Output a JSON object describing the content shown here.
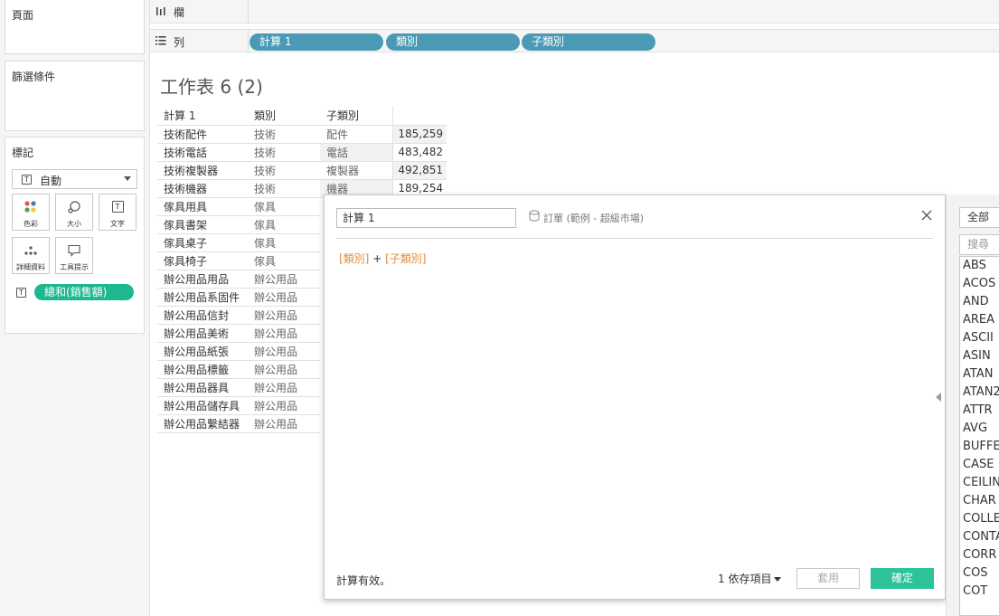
{
  "left_panel": {
    "pages_title": "頁面",
    "filters_title": "篩選條件",
    "marks_title": "標記",
    "mark_type": "自動",
    "mark_buttons": [
      {
        "label": "色彩",
        "icon": "color-icon"
      },
      {
        "label": "大小",
        "icon": "size-icon"
      },
      {
        "label": "文字",
        "icon": "text-icon"
      },
      {
        "label": "詳細資料",
        "icon": "detail-icon"
      },
      {
        "label": "工具提示",
        "icon": "tooltip-icon"
      }
    ],
    "text_mark_pill": "總和(銷售額)",
    "text_icon_glyph": "T"
  },
  "shelves": {
    "columns_label": "欄",
    "rows_label": "列",
    "row_pills": [
      "計算 1",
      "類別",
      "子類別"
    ]
  },
  "worksheet": {
    "title": "工作表 6 (2)",
    "headers": [
      "計算 1",
      "類別",
      "子類別",
      ""
    ],
    "rows": [
      [
        "技術配件",
        "技術",
        "配件",
        "185,259"
      ],
      [
        "技術電話",
        "技術",
        "電話",
        "483,482"
      ],
      [
        "技術複製器",
        "技術",
        "複製器",
        "492,851"
      ],
      [
        "技術機器",
        "技術",
        "機器",
        "189,254"
      ],
      [
        "傢具用具",
        "傢具",
        "",
        ""
      ],
      [
        "傢具書架",
        "傢具",
        "",
        ""
      ],
      [
        "傢具桌子",
        "傢具",
        "",
        ""
      ],
      [
        "傢具椅子",
        "傢具",
        "",
        ""
      ],
      [
        "辦公用品用品",
        "辦公用品",
        "",
        ""
      ],
      [
        "辦公用品系固件",
        "辦公用品",
        "",
        ""
      ],
      [
        "辦公用品信封",
        "辦公用品",
        "",
        ""
      ],
      [
        "辦公用品美術",
        "辦公用品",
        "",
        ""
      ],
      [
        "辦公用品紙張",
        "辦公用品",
        "",
        ""
      ],
      [
        "辦公用品標籤",
        "辦公用品",
        "",
        ""
      ],
      [
        "辦公用品器具",
        "辦公用品",
        "",
        ""
      ],
      [
        "辦公用品儲存具",
        "辦公用品",
        "",
        ""
      ],
      [
        "辦公用品繫結器",
        "辦公用品",
        "",
        ""
      ]
    ]
  },
  "calc_dialog": {
    "name": "計算 1",
    "datasource": "訂單 (範例 - 超級市場)",
    "formula_field1": "[類別]",
    "formula_op": " + ",
    "formula_field2": "[子類別]",
    "status": "計算有效。",
    "dependencies": "1 依存項目",
    "apply_label": "套用",
    "ok_label": "確定"
  },
  "function_panel": {
    "category": "全部",
    "search_placeholder": "搜尋",
    "functions": [
      "ABS",
      "ACOS",
      "AND",
      "AREA",
      "ASCII",
      "ASIN",
      "ATAN",
      "ATAN2",
      "ATTR",
      "AVG",
      "BUFFER",
      "CASE",
      "CEILING",
      "CHAR",
      "COLLECT",
      "CONTAINS",
      "CORR",
      "COS",
      "COT"
    ]
  },
  "colors": {
    "dimension_pill": "#4b9ab5",
    "measure_pill": "#1db890",
    "ok_button": "#2cc39a",
    "formula_field": "#e08b3a"
  }
}
